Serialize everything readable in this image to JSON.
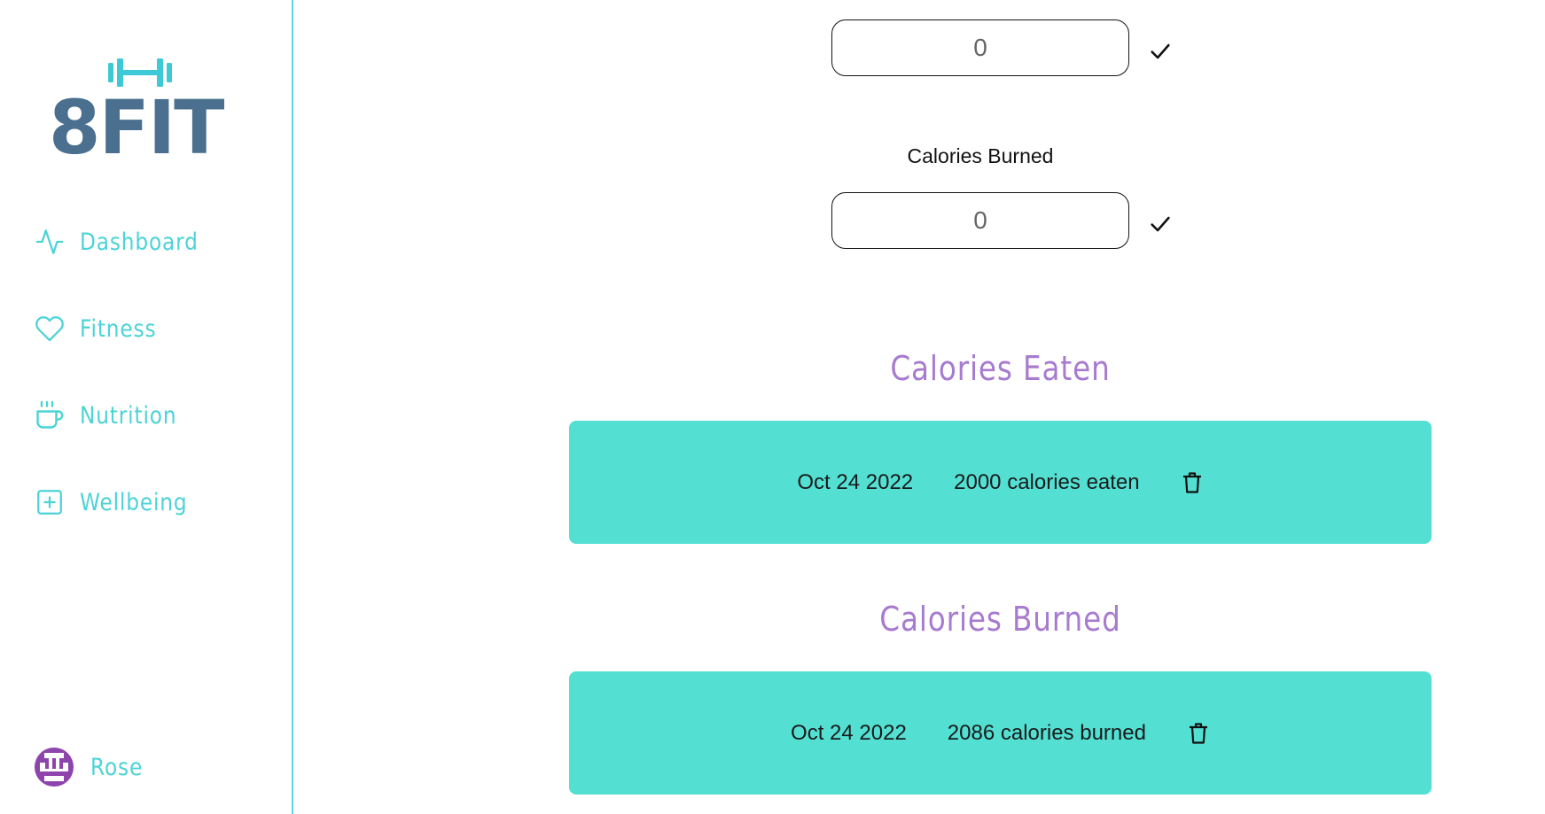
{
  "brand": {
    "logo_text": "8FIT",
    "logo_color": "#4a6f8f",
    "accent_color": "#4cd3d6",
    "dumbbell_icon": "dumbbell-icon"
  },
  "sidebar": {
    "items": [
      {
        "label": "Dashboard",
        "icon": "activity-icon"
      },
      {
        "label": "Fitness",
        "icon": "heart-icon"
      },
      {
        "label": "Nutrition",
        "icon": "coffee-cup-icon"
      },
      {
        "label": "Wellbeing",
        "icon": "plus-square-icon"
      }
    ],
    "user": {
      "name": "Rose",
      "avatar_icon": "avatar-icon",
      "avatar_color": "#8e44ad"
    }
  },
  "main": {
    "calories_eaten_input": {
      "value": "",
      "placeholder": "0",
      "confirm_icon": "check-icon"
    },
    "calories_burned_input": {
      "label": "Calories Burned",
      "value": "",
      "placeholder": "0",
      "confirm_icon": "check-icon"
    },
    "eaten_section": {
      "title": "Calories Eaten",
      "entries": [
        {
          "date": "Oct 24 2022",
          "amount": "2000 calories eaten",
          "delete_icon": "trash-icon"
        }
      ]
    },
    "burned_section": {
      "title": "Calories Burned",
      "entries": [
        {
          "date": "Oct 24 2022",
          "amount": "2086 calories burned",
          "delete_icon": "trash-icon"
        }
      ]
    },
    "card_color": "#53e0d3",
    "title_color": "#a77bcf"
  }
}
